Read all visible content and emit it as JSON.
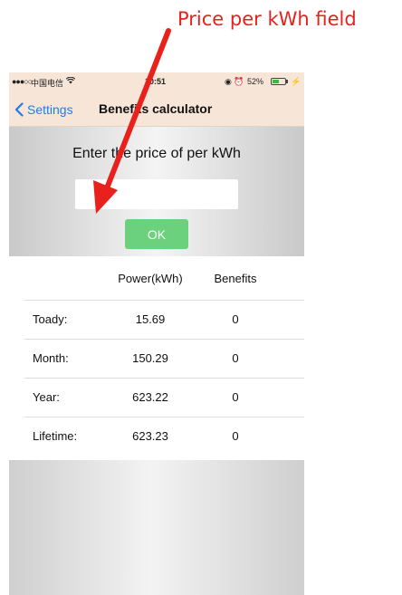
{
  "annotation": {
    "text": "Price per kWh field",
    "color": "#e8211d"
  },
  "status_bar": {
    "signal": "●●●○○",
    "carrier": "中国电信",
    "wifi": "wifi-icon",
    "time": "10:51",
    "indicators": "◉ ⏰",
    "battery": "52%",
    "charge": "⚡"
  },
  "nav": {
    "back_label": "Settings",
    "title": "Benefits calculator"
  },
  "entry": {
    "prompt": "Enter the price of per kWh",
    "input_value": "",
    "ok_label": "OK"
  },
  "table": {
    "headers": [
      "",
      "Power(kWh)",
      "Benefits"
    ],
    "rows": [
      {
        "label": "Toady:",
        "power": "15.69",
        "benefits": "0"
      },
      {
        "label": "Month:",
        "power": "150.29",
        "benefits": "0"
      },
      {
        "label": "Year:",
        "power": "623.22",
        "benefits": "0"
      },
      {
        "label": "Lifetime:",
        "power": "623.23",
        "benefits": "0"
      }
    ]
  },
  "colors": {
    "accent": "#1c7cf4",
    "nav_background": "#f7e6d7",
    "ok_button": "#6bd17d"
  }
}
